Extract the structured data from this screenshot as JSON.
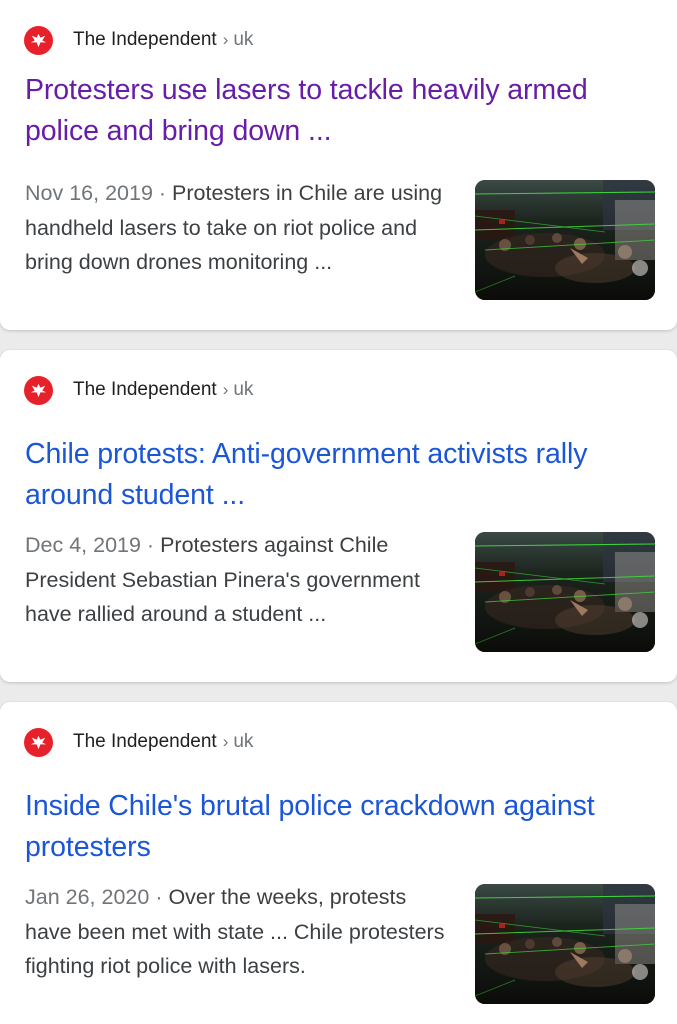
{
  "results": [
    {
      "source": "The Independent",
      "path_sep": "›",
      "path": "uk",
      "title": "Protesters use lasers to tackle heavily armed police and bring down ...",
      "visited": true,
      "date": "Nov 16, 2019",
      "date_sep": " · ",
      "snippet": "Protesters in Chile are using handheld lasers to take on riot police and bring down drones monitoring ...",
      "thumbnail_icon": "protest-lasers-photo"
    },
    {
      "source": "The Independent",
      "path_sep": "›",
      "path": "uk",
      "title": "Chile protests: Anti-government activists rally around student ...",
      "visited": false,
      "date": "Dec 4, 2019",
      "date_sep": " · ",
      "snippet": "Protesters against Chile President Sebastian Pinera's government have rallied around a student ...",
      "thumbnail_icon": "protest-lasers-photo"
    },
    {
      "source": "The Independent",
      "path_sep": "›",
      "path": "uk",
      "title": "Inside Chile's brutal police crackdown against protesters",
      "visited": false,
      "date": "Jan 26, 2020",
      "date_sep": " · ",
      "snippet": "Over the weeks, protests have been met with state ... Chile protesters fighting riot police with lasers.",
      "thumbnail_icon": "protest-lasers-photo"
    }
  ],
  "colors": {
    "visited_link": "#681da8",
    "link": "#1a56d6",
    "favicon_red": "#e8202a",
    "laser_green": "#3ee23a"
  },
  "favicon_icon": "independent-eagle-icon"
}
